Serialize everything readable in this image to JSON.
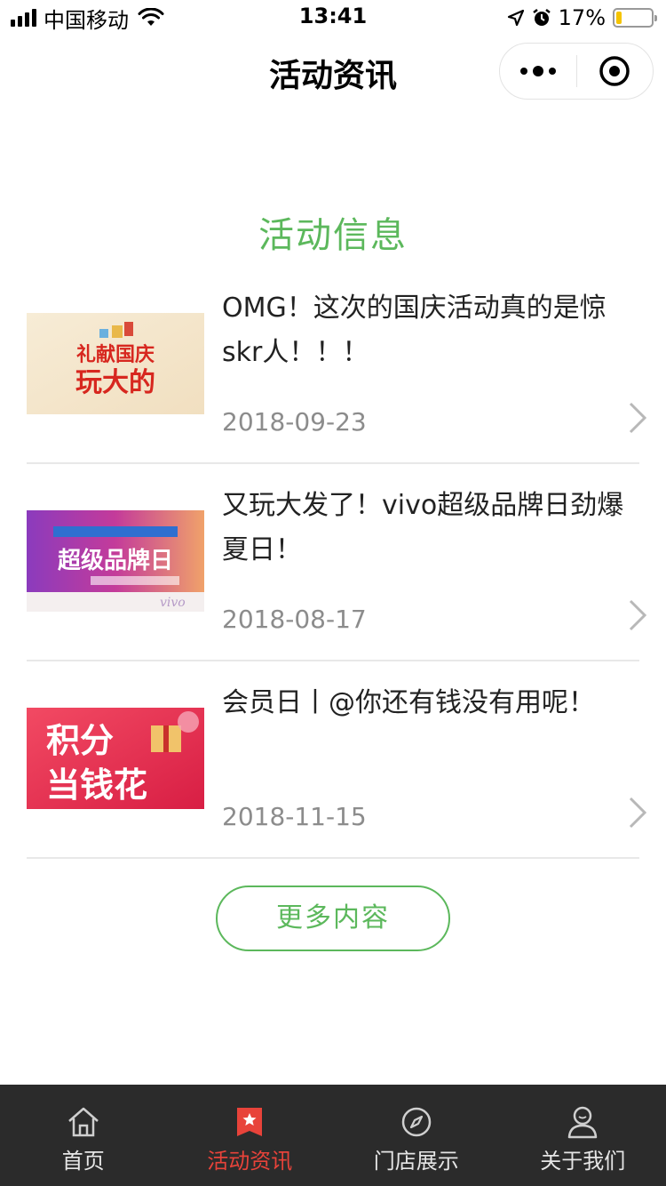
{
  "status_bar": {
    "carrier": "中国移动",
    "time": "13:41",
    "battery": "17%",
    "battery_level": 0.17
  },
  "nav": {
    "title": "活动资讯",
    "more_icon": "more-dots-icon",
    "close_icon": "target-close-icon"
  },
  "section": {
    "title": "活动信息"
  },
  "news": [
    {
      "title": "OMG！这次的国庆活动真的是惊skr人！！！",
      "date": "2018-09-23",
      "thumb_text": "礼献国庆 玩大的"
    },
    {
      "title": "又玩大发了！vivo超级品牌日劲爆夏日！",
      "date": "2018-08-17",
      "thumb_text": "超级品牌日"
    },
    {
      "title": "会员日丨@你还有钱没有用呢！",
      "date": "2018-11-15",
      "thumb_text": "积分 当钱花"
    }
  ],
  "more_button": "更多内容",
  "tabs": [
    {
      "label": "首页",
      "icon": "home-icon",
      "active": false
    },
    {
      "label": "活动资讯",
      "icon": "star-bookmark-icon",
      "active": true
    },
    {
      "label": "门店展示",
      "icon": "compass-icon",
      "active": false
    },
    {
      "label": "关于我们",
      "icon": "user-icon",
      "active": false
    }
  ],
  "colors": {
    "accent_green": "#5cb85c",
    "active_red": "#e8433a",
    "tab_bg": "#2b2b2b",
    "battery_yellow": "#f5c400"
  }
}
